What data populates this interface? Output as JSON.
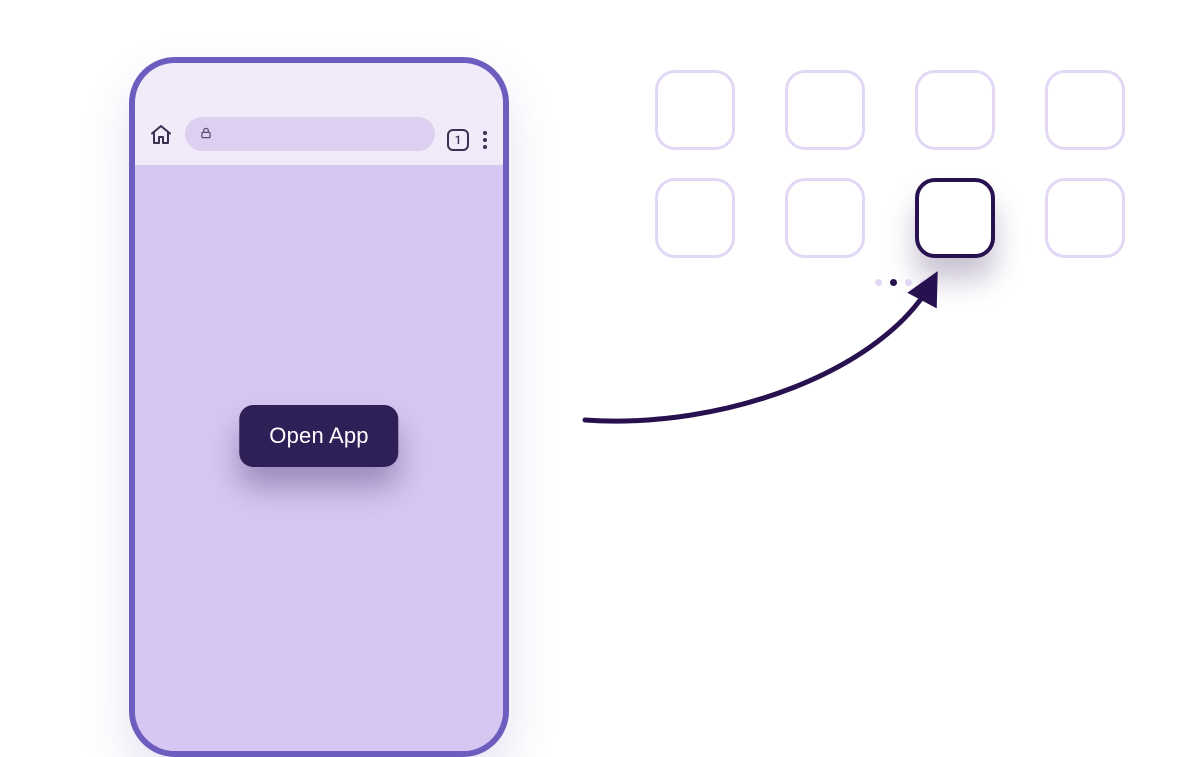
{
  "phone": {
    "tab_count": "1",
    "open_button_label": "Open App"
  },
  "grid": {
    "rows": 2,
    "cols": 4,
    "highlighted_index": 6
  },
  "dots": {
    "count": 4,
    "active_index": 1
  },
  "colors": {
    "accent_dark": "#27114f",
    "phone_border": "#6c5dbe",
    "page_bg": "#d6c6f2",
    "icon_ghost": "#e2d8f5"
  }
}
